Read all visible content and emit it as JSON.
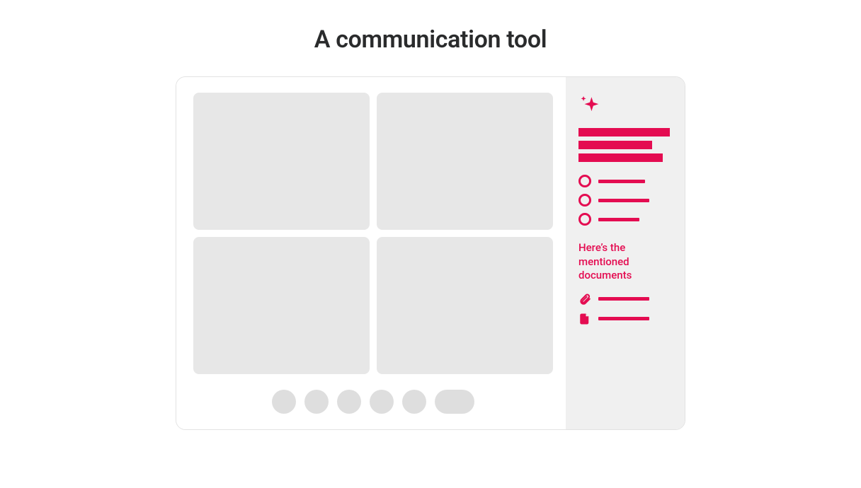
{
  "title": "A communication tool",
  "colors": {
    "accent": "#e40c51",
    "placeholder": "#e7e7e7",
    "control": "#dedede",
    "panel_bg": "#f0f0f0"
  },
  "main": {
    "video_tiles": 4,
    "controls": {
      "circles": 5,
      "pill": 1
    }
  },
  "side_panel": {
    "sparkle_icon": "sparkle",
    "heading_bars": 3,
    "option_items": 3,
    "documents_heading": "Here’s the mentioned documents",
    "documents": [
      {
        "icon": "paperclip"
      },
      {
        "icon": "file"
      }
    ]
  }
}
